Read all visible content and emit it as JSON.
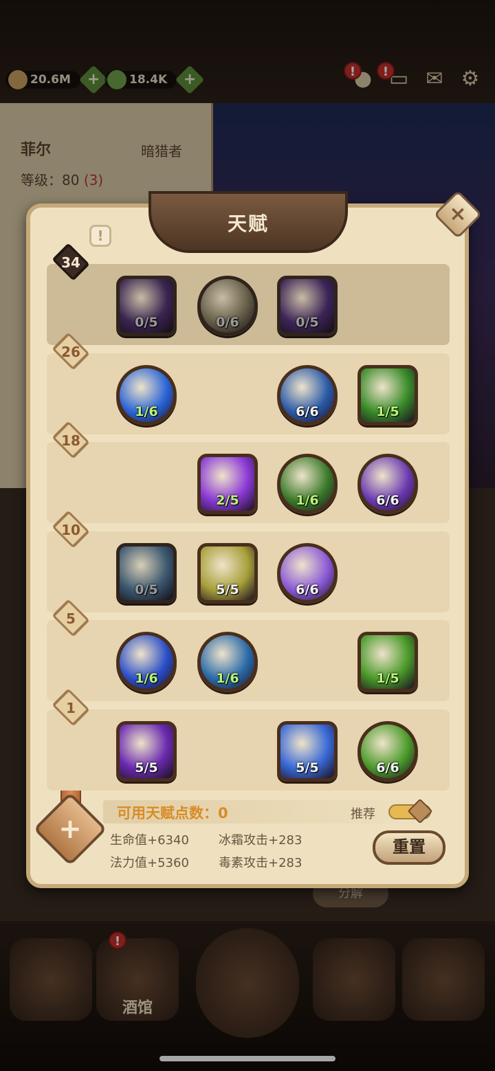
{
  "resources": [
    {
      "value": "20.6M",
      "icon": "gold-coin-icon",
      "color": "#c8a060"
    },
    {
      "value": "18.4K",
      "icon": "green-leaf-icon",
      "color": "#6fa04a"
    }
  ],
  "hero": {
    "name": "菲尔",
    "class": "暗猎者",
    "level_label": "等级：",
    "level": "80",
    "level_up": "(3)"
  },
  "bottom_buttons": {
    "decompose": "分解"
  },
  "nav": {
    "tavern": "酒馆"
  },
  "panel": {
    "title": "天赋",
    "info_icon": "!",
    "close_icon": "×",
    "tiers": [
      {
        "level": "34",
        "skills": [
          {
            "col": 0,
            "shape": "square",
            "progress": "0/5",
            "state": "off",
            "color": "#5a2a8c"
          },
          {
            "col": 1,
            "shape": "round",
            "progress": "0/6",
            "state": "off",
            "color": "#8a7a4a"
          },
          {
            "col": 2,
            "shape": "square",
            "progress": "0/5",
            "state": "off",
            "color": "#5e2a9a"
          }
        ]
      },
      {
        "level": "26",
        "skills": [
          {
            "col": 0,
            "shape": "round",
            "progress": "1/6",
            "state": "on",
            "color": "#2a64d6"
          },
          {
            "col": 2,
            "shape": "round",
            "progress": "6/6",
            "state": "max",
            "color": "#2a5aa8"
          },
          {
            "col": 3,
            "shape": "square",
            "progress": "1/5",
            "state": "on",
            "color": "#3a8c2a"
          }
        ]
      },
      {
        "level": "18",
        "skills": [
          {
            "col": 1,
            "shape": "square",
            "progress": "2/5",
            "state": "on",
            "color": "#8a3ad6"
          },
          {
            "col": 2,
            "shape": "round",
            "progress": "1/6",
            "state": "on",
            "color": "#3a7a2a"
          },
          {
            "col": 3,
            "shape": "round",
            "progress": "6/6",
            "state": "max",
            "color": "#6a3ab0"
          }
        ]
      },
      {
        "level": "10",
        "skills": [
          {
            "col": 0,
            "shape": "square",
            "progress": "0/5",
            "state": "off",
            "color": "#3a7ab0"
          },
          {
            "col": 1,
            "shape": "square",
            "progress": "5/5",
            "state": "max",
            "color": "#a8a03a"
          },
          {
            "col": 2,
            "shape": "round",
            "progress": "6/6",
            "state": "max",
            "color": "#8a5ad6"
          }
        ]
      },
      {
        "level": "5",
        "skills": [
          {
            "col": 0,
            "shape": "round",
            "progress": "1/6",
            "state": "on",
            "color": "#2a4ec8"
          },
          {
            "col": 1,
            "shape": "round",
            "progress": "1/6",
            "state": "on",
            "color": "#2a6aa8"
          },
          {
            "col": 3,
            "shape": "square",
            "progress": "1/5",
            "state": "on",
            "color": "#4a9a2a"
          }
        ]
      },
      {
        "level": "1",
        "skills": [
          {
            "col": 0,
            "shape": "square",
            "progress": "5/5",
            "state": "max",
            "color": "#6a2ab0"
          },
          {
            "col": 2,
            "shape": "square",
            "progress": "5/5",
            "state": "max",
            "color": "#3a6ad6"
          },
          {
            "col": 3,
            "shape": "round",
            "progress": "6/6",
            "state": "max",
            "color": "#4a9a2a"
          }
        ]
      }
    ],
    "available_points_label": "可用天赋点数：",
    "available_points": "0",
    "recommend_label": "推荐",
    "recommend_on": true,
    "stats": {
      "hp": "生命值+6340",
      "mp": "法力值+5360",
      "frost": "冰霜攻击+283",
      "poison": "毒素攻击+283"
    },
    "reset_label": "重置",
    "add_icon": "+"
  }
}
